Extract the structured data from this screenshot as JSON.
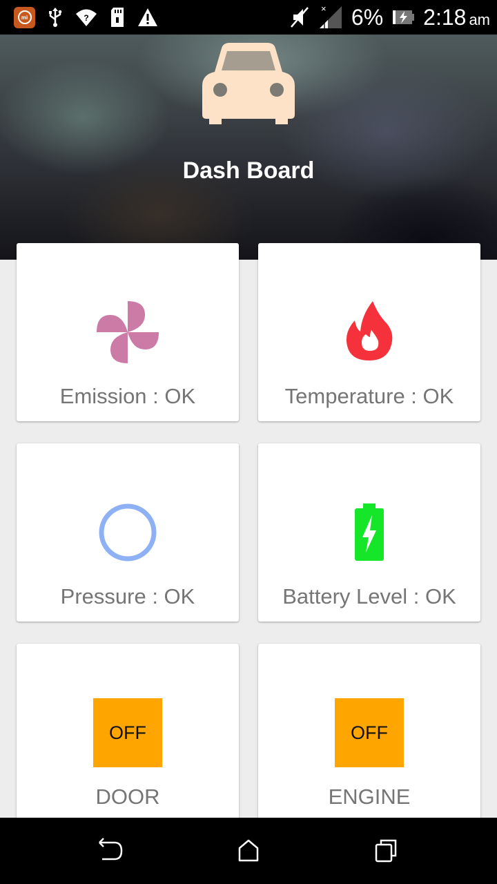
{
  "status_bar": {
    "battery_percent": "6%",
    "time": "2:18",
    "time_suffix": "am"
  },
  "header": {
    "title": "Dash Board",
    "icon": "car-icon"
  },
  "cards": [
    {
      "icon": "fan-icon",
      "label": "Emission : OK"
    },
    {
      "icon": "flame-icon",
      "label": "Temperature : OK"
    },
    {
      "icon": "circle-gauge-icon",
      "label": "Pressure : OK"
    },
    {
      "icon": "battery-charging-icon",
      "label": "Battery Level : OK"
    },
    {
      "toggle": "OFF",
      "label": "DOOR"
    },
    {
      "toggle": "OFF",
      "label": "ENGINE"
    }
  ],
  "colors": {
    "accent_orange": "#ffa500",
    "fan": "#cc7aa6",
    "flame": "#f5323c",
    "pressure_ring": "#8eb1f5",
    "battery": "#16e62a"
  }
}
